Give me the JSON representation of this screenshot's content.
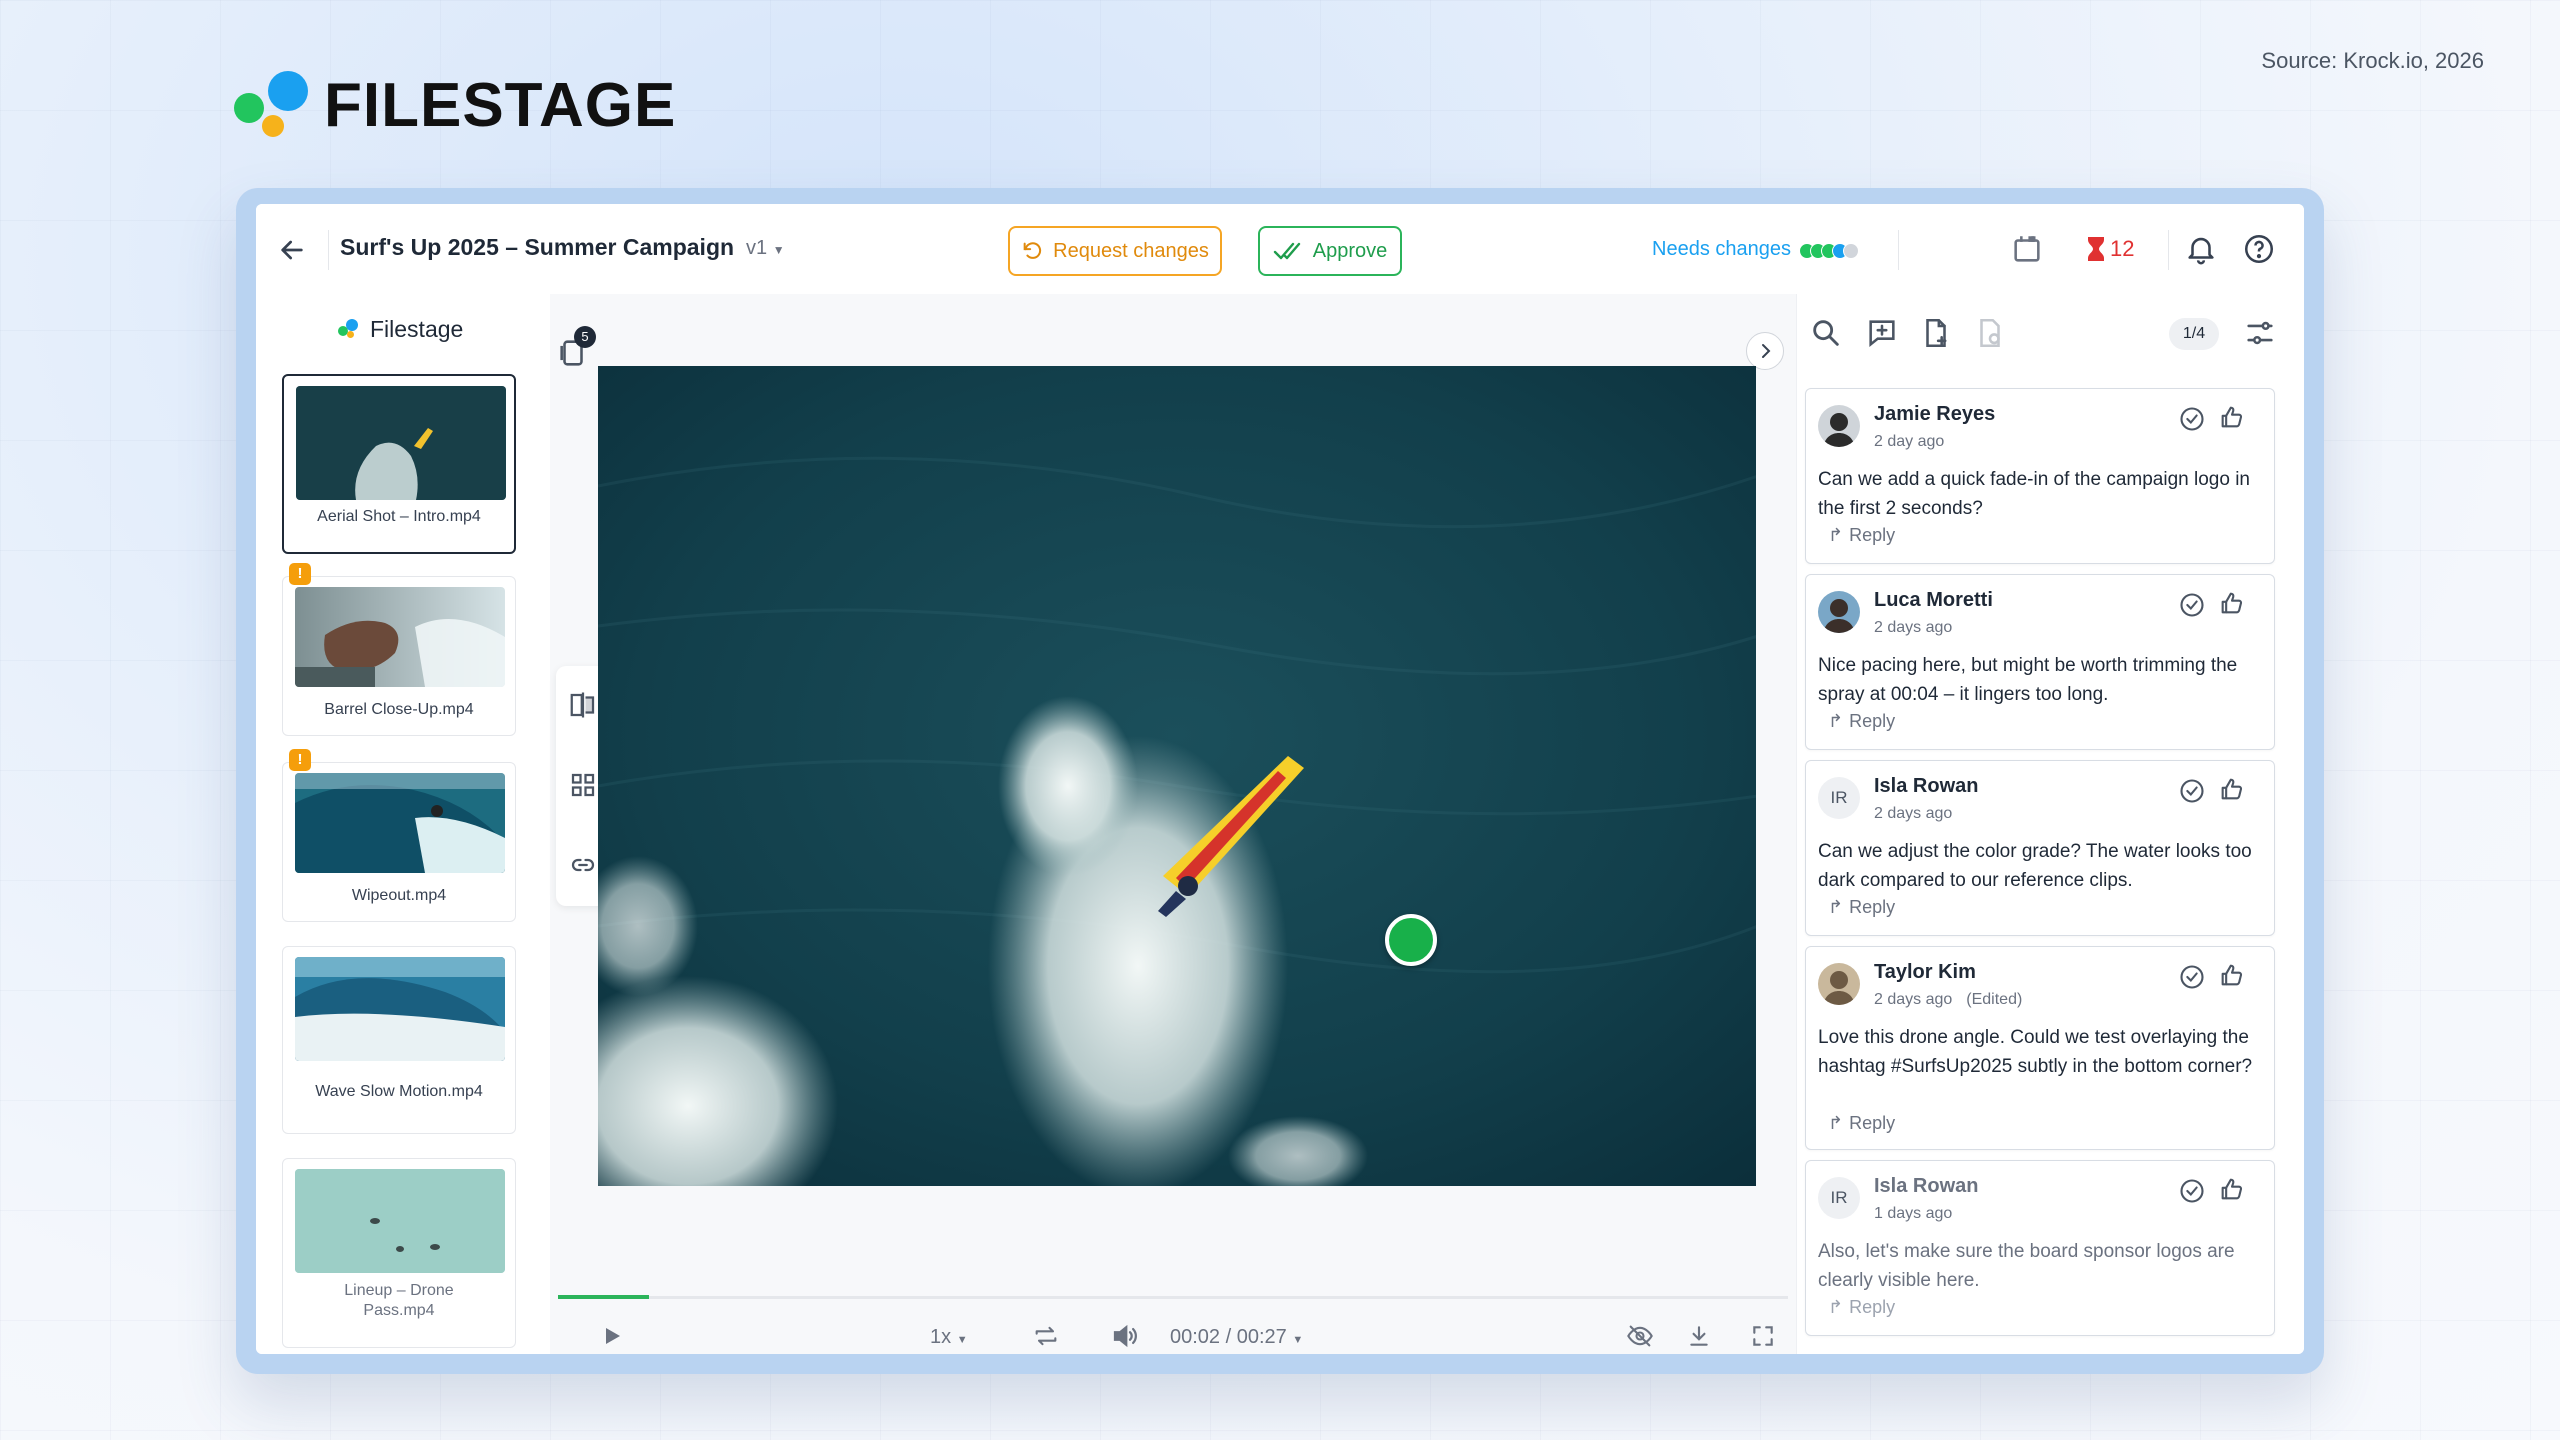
{
  "brand": {
    "name": "FILESTAGE"
  },
  "source": "Source: Krock.io, 2026",
  "header": {
    "title": "Surf's Up 2025 – Summer Campaign",
    "version": "v1",
    "request_label": "Request changes",
    "approve_label": "Approve",
    "status": "Needs changes",
    "reviewer_pips": [
      "#22c55e",
      "#22c55e",
      "#22c55e",
      "#1aa0f0",
      "#d1d5db"
    ],
    "timer_count": "12"
  },
  "sidebar": {
    "logo": "Filestage",
    "files": [
      {
        "name": "Aerial Shot – Intro.mp4",
        "warning": false,
        "selected": true
      },
      {
        "name": "Barrel Close-Up.mp4",
        "warning": true,
        "selected": false
      },
      {
        "name": "Wipeout.mp4",
        "warning": true,
        "selected": false
      },
      {
        "name": "Wave Slow Motion.mp4",
        "warning": false,
        "selected": false
      },
      {
        "name": "Lineup – Drone Pass.mp4",
        "warning": false,
        "selected": false
      }
    ]
  },
  "viewer": {
    "layers_count": "5",
    "speed": "1x",
    "timecode": "00:02 / 00:27",
    "progress": 0.074
  },
  "panel": {
    "counter": "1/4",
    "reply_label": "Reply",
    "comments": [
      {
        "author": "Jamie Reyes",
        "initials": "",
        "time": "2 day ago",
        "edited": "",
        "text": "Can we add a quick fade-in of the campaign logo in the first 2 seconds?"
      },
      {
        "author": "Luca Moretti",
        "initials": "",
        "time": "2 days ago",
        "edited": "",
        "text": "Nice pacing here, but might be worth trimming the spray at 00:04 – it lingers too long."
      },
      {
        "author": "Isla Rowan",
        "initials": "IR",
        "time": "2 days ago",
        "edited": "",
        "text": "Can we adjust the color grade? The water looks too dark compared to our reference clips."
      },
      {
        "author": "Taylor Kim",
        "initials": "",
        "time": "2 days ago",
        "edited": "(Edited)",
        "text": "Love this drone angle. Could we test overlaying the hashtag #SurfsUp2025 subtly in the bottom corner?"
      },
      {
        "author": "Isla Rowan",
        "initials": "IR",
        "time": "1 days ago",
        "edited": "",
        "text": "Also, let's make sure the board sponsor logos are clearly visible here."
      }
    ]
  },
  "colors": {
    "accent_blue": "#1aa0f0",
    "approve_green": "#2bb45a",
    "request_orange": "#f5a524",
    "alert_red": "#e03131"
  }
}
